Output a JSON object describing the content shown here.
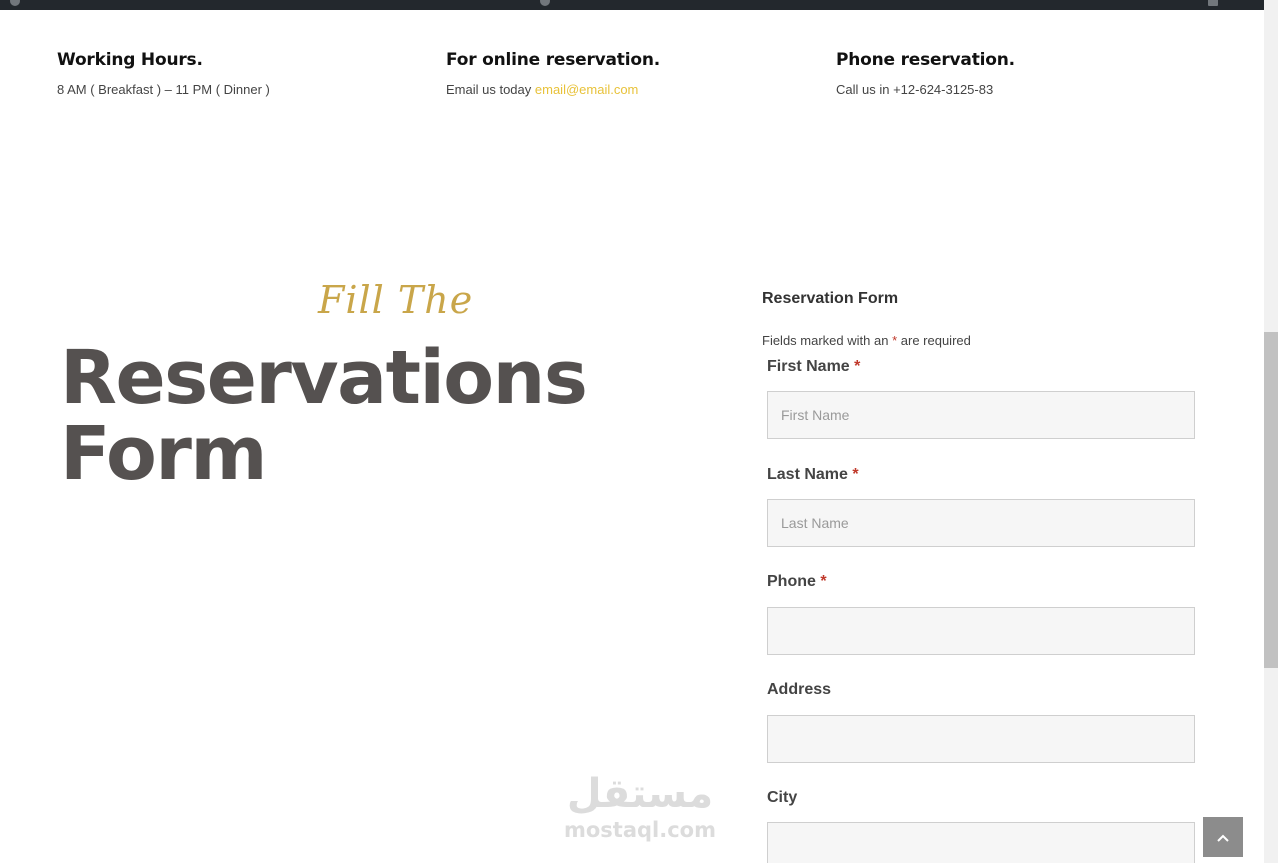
{
  "info": {
    "hours": {
      "title": "Working Hours.",
      "text": "8 AM ( Breakfast ) – 11 PM ( Dinner )"
    },
    "online": {
      "title": "For online reservation.",
      "text": "Email us today",
      "email": "email@email.com"
    },
    "phone": {
      "title": "Phone reservation.",
      "text": "Call us in +12-624-3125-83"
    }
  },
  "hero": {
    "script": "Fill The",
    "title_line1": "Reservations",
    "title_line2": "Form"
  },
  "form": {
    "title": "Reservation Form",
    "note_before": "Fields marked with an",
    "note_star": "*",
    "note_after": "are required",
    "fields": [
      {
        "label": "First Name",
        "required": "*",
        "placeholder": "First Name"
      },
      {
        "label": "Last Name",
        "required": "*",
        "placeholder": "Last Name"
      },
      {
        "label": "Phone",
        "required": "*",
        "placeholder": ""
      },
      {
        "label": "Address",
        "required": "",
        "placeholder": ""
      },
      {
        "label": "City",
        "required": "",
        "placeholder": ""
      }
    ]
  },
  "watermark": {
    "arabic": "مستقل",
    "latin": "mostaql.com"
  },
  "colors": {
    "accent_gold": "#c9a64a",
    "link_yellow": "#e8c23a",
    "required_red": "#c0392b",
    "title_gray": "#555150"
  },
  "icons": {
    "back_to_top": "chevron-up-icon"
  }
}
